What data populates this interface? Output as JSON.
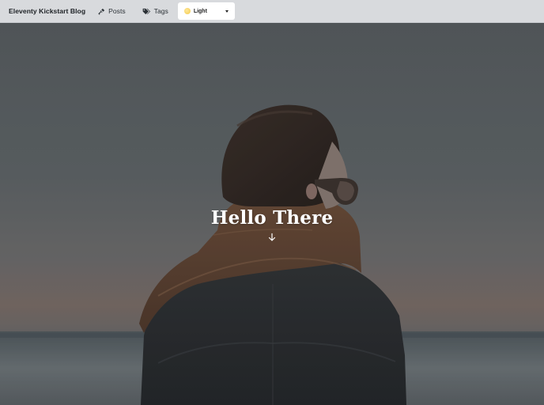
{
  "navbar": {
    "brand": "Eleventy Kickstart Blog",
    "links": [
      {
        "label": "Posts",
        "icon": "plug-icon"
      },
      {
        "label": "Tags",
        "icon": "tags-icon"
      }
    ],
    "theme_select": {
      "value": "Light",
      "icon": "sun-icon"
    }
  },
  "hero": {
    "title": "Hello There",
    "scroll_icon": "arrow-down-icon",
    "background_image": "person-in-leather-jacket-and-scarf-facing-sea"
  },
  "colors": {
    "navbar_bg": "#d8dadd",
    "select_bg": "#ffffff",
    "title_text": "#ffffff"
  }
}
